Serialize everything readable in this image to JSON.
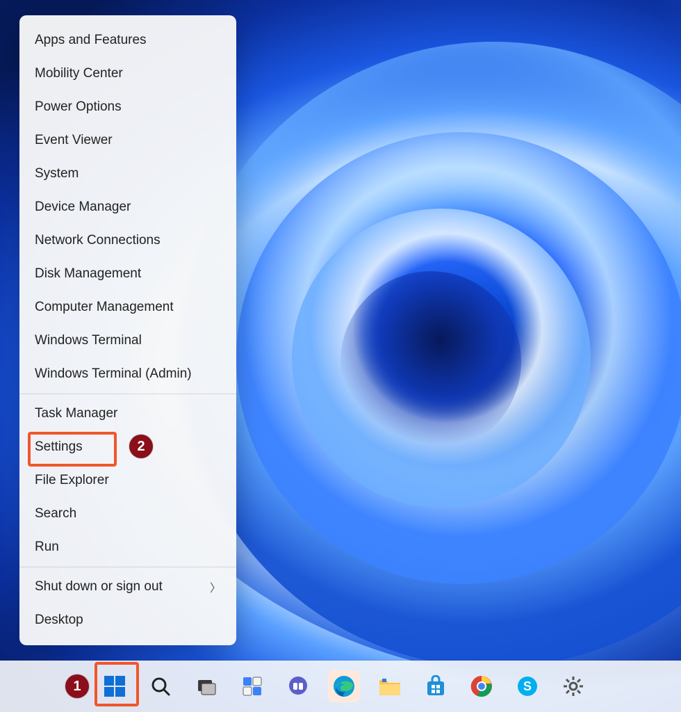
{
  "menu": {
    "group1": [
      "Apps and Features",
      "Mobility Center",
      "Power Options",
      "Event Viewer",
      "System",
      "Device Manager",
      "Network Connections",
      "Disk Management",
      "Computer Management",
      "Windows Terminal",
      "Windows Terminal (Admin)"
    ],
    "group2": [
      "Task Manager",
      "Settings",
      "File Explorer",
      "Search",
      "Run"
    ],
    "group3_submenu": "Shut down or sign out",
    "group3_last": "Desktop"
  },
  "callouts": {
    "start": "1",
    "settings": "2"
  },
  "taskbar": {
    "icons": [
      "start",
      "search",
      "task-view",
      "widgets",
      "chat",
      "edge",
      "file-explorer",
      "store",
      "chrome",
      "skype",
      "settings"
    ]
  },
  "colors": {
    "highlight": "#f2552a",
    "callout_bg": "#8b0e1a"
  }
}
